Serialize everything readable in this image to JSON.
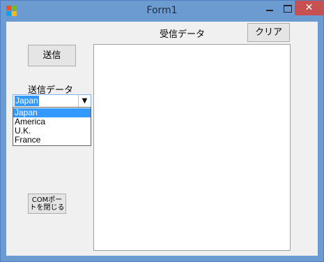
{
  "window": {
    "title": "Form1",
    "close_glyph": "✕",
    "icon": "app-icon"
  },
  "form": {
    "send_button": "送信",
    "send_data_label": "送信データ",
    "received_data_label": "受信データ",
    "clear_button": "クリア",
    "com_close_button": "COMポートを閉じる",
    "com_close_button_lines": [
      "COMポー",
      "トを閉じる"
    ],
    "combo": {
      "selected": "Japan",
      "options": [
        "Japan",
        "America",
        "U.K.",
        "France"
      ],
      "highlighted_index": 0
    },
    "received_text": ""
  },
  "colors": {
    "titlebar": "#6c9bd1",
    "close_button": "#c75050",
    "selection": "#3399ff",
    "client_background": "#f0f0f0"
  }
}
